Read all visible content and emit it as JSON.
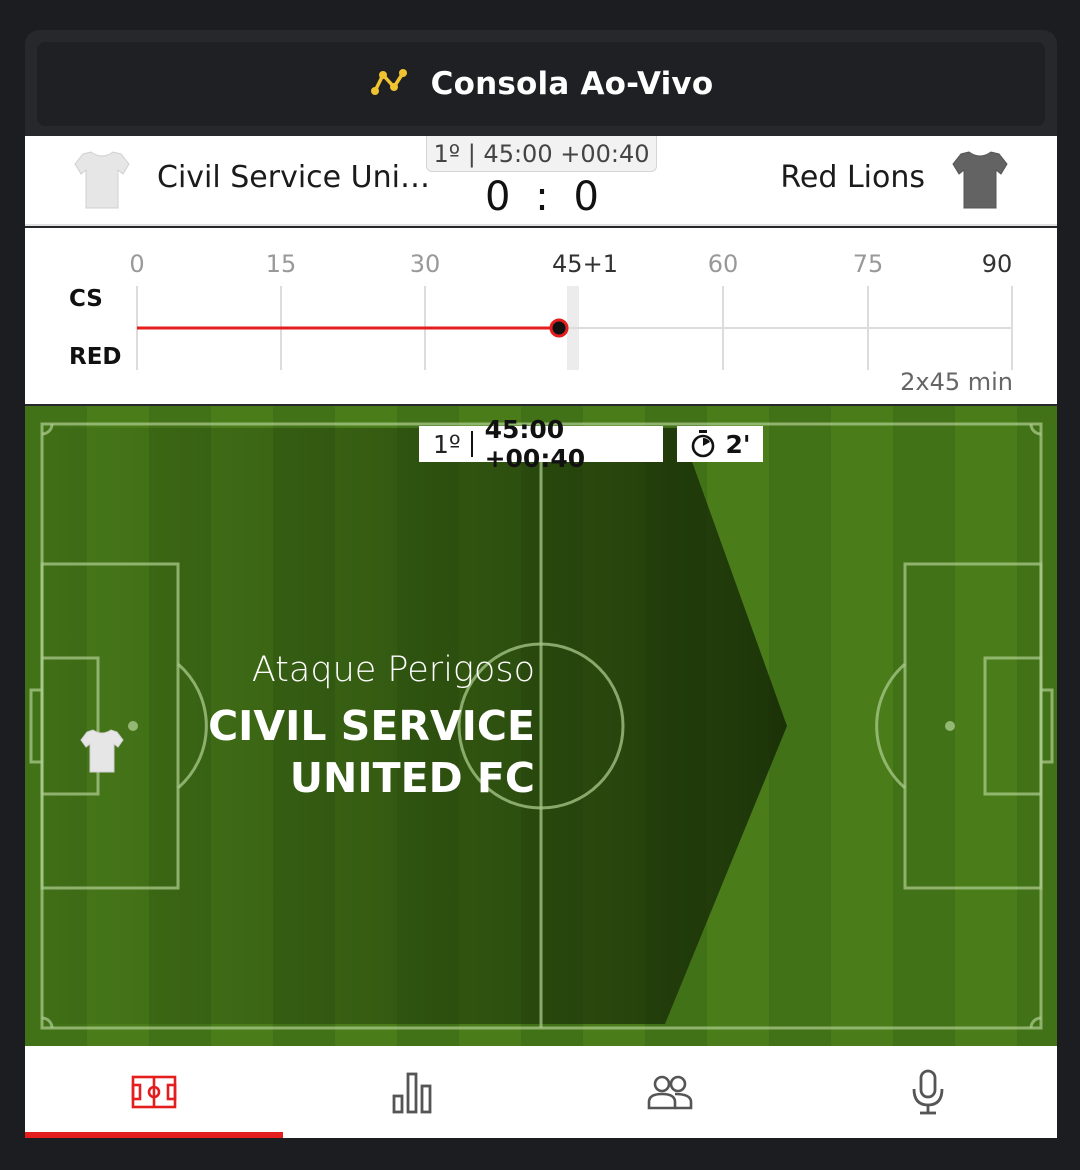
{
  "header": {
    "title": "Consola Ao-Vivo",
    "icon": "live-graph-icon",
    "accent": "#f0c330"
  },
  "match": {
    "home": {
      "name": "Civil Service Uni…",
      "short": "CS",
      "shirt_color": "#e6e6e6",
      "full_name": "CIVIL SERVICE UNITED FC"
    },
    "away": {
      "name": "Red Lions",
      "short": "RED",
      "shirt_color": "#636363"
    },
    "period": "1º",
    "clock": "45:00 +00:40",
    "clock_label": "1º | 45:00 +00:40",
    "score_home": "0",
    "score_sep": ":",
    "score_away": "0"
  },
  "timeline": {
    "ticks": [
      "0",
      "15",
      "30",
      "45+1",
      "60",
      "75",
      "90"
    ],
    "duration": "2x45 min",
    "progress_minute": 45.67,
    "accent": "#e41e1e"
  },
  "pitch": {
    "period": "1º",
    "clock": "45:00 +00:40",
    "timer_value": "2'",
    "event_title": "Ataque Perigoso",
    "event_team_line1": "CIVIL SERVICE",
    "event_team_line2": "UNITED FC",
    "grass_light": "#4a7d1a",
    "grass_dark": "#3d6b14"
  },
  "tabs": [
    {
      "name": "tab-pitch",
      "icon": "pitch-icon",
      "active": true
    },
    {
      "name": "tab-stats",
      "icon": "bar-chart-icon",
      "active": false
    },
    {
      "name": "tab-lineups",
      "icon": "players-icon",
      "active": false
    },
    {
      "name": "tab-commentary",
      "icon": "microphone-icon",
      "active": false
    }
  ]
}
